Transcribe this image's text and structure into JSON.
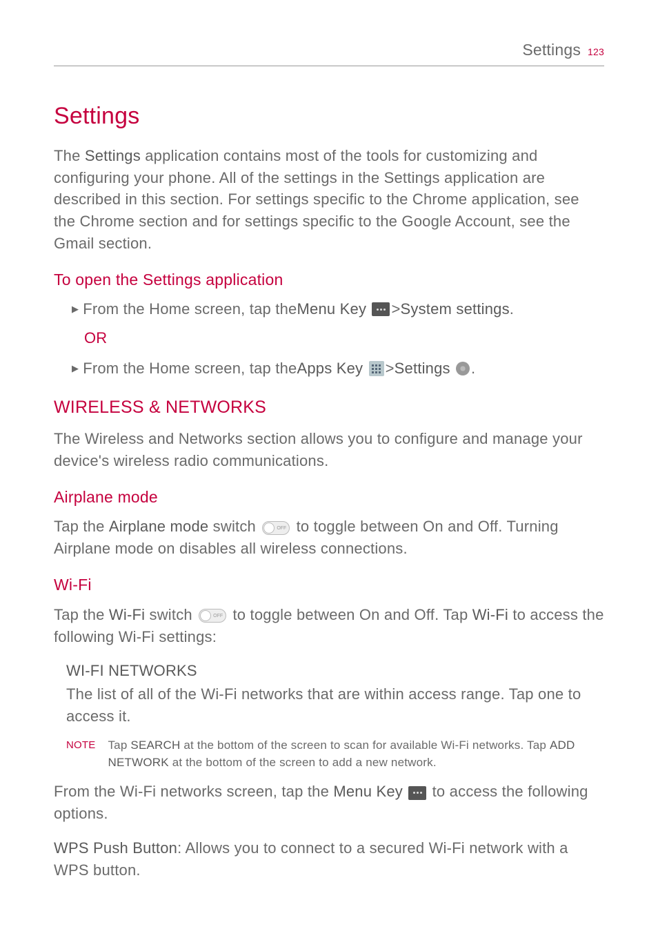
{
  "header": {
    "title": "Settings",
    "page": "123"
  },
  "h1": "Settings",
  "intro": "The Settings application contains most of the tools for customizing and configuring your phone. All of the settings in the Settings application are described in this section. For settings specific to the Chrome application, see the Chrome section and for settings specific to the Google Account, see the Gmail section.",
  "open_heading": "To open the Settings application",
  "bullet1_a": "From the Home screen, tap the ",
  "bullet1_b": "Menu Key",
  "bullet1_c": " > ",
  "bullet1_d": "System settings",
  "bullet1_e": ".",
  "or": "OR",
  "bullet2_a": "From the Home screen, tap the ",
  "bullet2_b": "Apps Key",
  "bullet2_c": " > ",
  "bullet2_d": "Settings",
  "bullet2_e": " .",
  "wireless_h": "WIRELESS & NETWORKS",
  "wireless_p": "The Wireless and Networks section allows you to configure and manage your device's wireless radio communications.",
  "airplane_h": "Airplane mode",
  "airplane_a": "Tap the ",
  "airplane_b": "Airplane mode",
  "airplane_c": " switch ",
  "airplane_d": " to toggle between On and Off. Turning Airplane mode on disables all wireless connections.",
  "wifi_h": "Wi-Fi",
  "wifi_a": "Tap the ",
  "wifi_b": "Wi-Fi",
  "wifi_c": " switch ",
  "wifi_d": " to toggle between On and Off. Tap ",
  "wifi_e": "Wi-Fi",
  "wifi_f": " to access the following Wi-Fi settings:",
  "wn_h": "WI-FI NETWORKS",
  "wn_p": "The list of all of the Wi-Fi networks that are within access range. Tap one to access it.",
  "note_label": "NOTE",
  "note_a": "Tap ",
  "note_b": "SEARCH",
  "note_c": " at the bottom of the screen to scan for available Wi-Fi networks. Tap ",
  "note_d": "ADD NETWORK",
  "note_e": " at the bottom of the screen to add a new network.",
  "from_a": "From the Wi-Fi networks screen, tap the ",
  "from_b": "Menu Key",
  "from_c": " to access the following options.",
  "wps_a": "WPS Push Button",
  "wps_b": ": Allows you to connect to a secured Wi-Fi network with a WPS button.",
  "switch_off": "OFF"
}
